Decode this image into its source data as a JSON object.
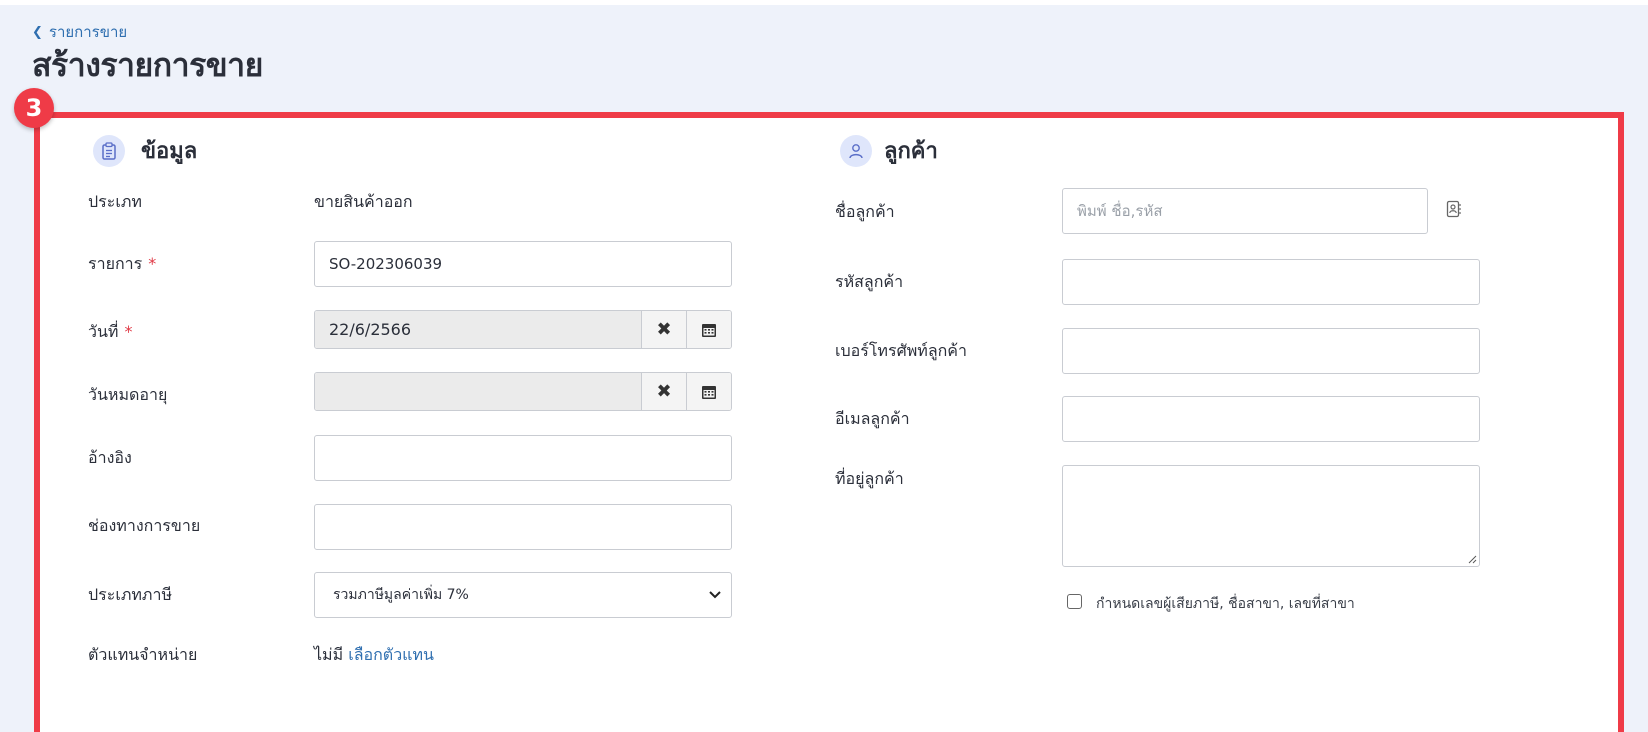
{
  "breadcrumb": {
    "label": "รายการขาย"
  },
  "page": {
    "title": "สร้างรายการขาย"
  },
  "step_badge": "3",
  "info_section": {
    "title": "ข้อมูล",
    "icon": "clipboard-icon",
    "type_label": "ประเภท",
    "type_value": "ขายสินค้าออก",
    "doc_label": "รายการ",
    "doc_required": "*",
    "doc_value": "SO-202306039",
    "date_label": "วันที่",
    "date_required": "*",
    "date_value": "22/6/2566",
    "expire_label": "วันหมดอายุ",
    "expire_value": "",
    "ref_label": "อ้างอิง",
    "ref_value": "",
    "channel_label": "ช่องทางการขาย",
    "channel_value": "",
    "tax_label": "ประเภทภาษี",
    "tax_value": "รวมภาษีมูลค่าเพิ่ม 7%",
    "agent_label": "ตัวแทนจำหน่าย",
    "agent_none": "ไม่มี",
    "agent_link": "เลือกตัวแทน"
  },
  "customer_section": {
    "title": "ลูกค้า",
    "icon": "user-icon",
    "name_label": "ชื่อลูกค้า",
    "name_placeholder": "พิมพ์ ชื่อ,รหัส",
    "code_label": "รหัสลูกค้า",
    "phone_label": "เบอร์โทรศัพท์ลูกค้า",
    "email_label": "อีเมลลูกค้า",
    "address_label": "ที่อยู่ลูกค้า",
    "tax_checkbox_label": "กำหนดเลขผู้เสียภาษี, ชื่อสาขา, เลขที่สาขา"
  },
  "colors": {
    "accent": "#2f6fb0",
    "highlight": "#ef3b47",
    "background": "#eef2fa"
  }
}
